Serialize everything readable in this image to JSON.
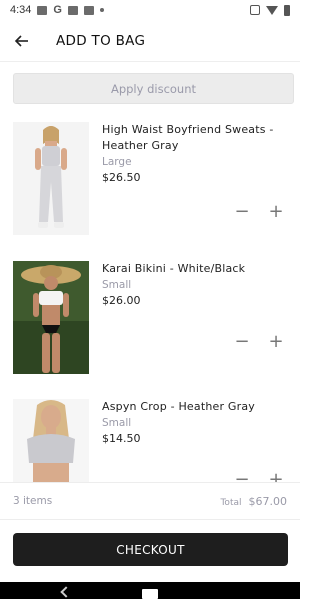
{
  "status_bar": {
    "time": "4:34",
    "icons": [
      "image-icon",
      "google-icon",
      "photo-icon",
      "square-icon",
      "dot-icon",
      "vibrate-icon",
      "wifi-icon",
      "battery-icon"
    ]
  },
  "header": {
    "title": "ADD TO BAG",
    "back_icon": "arrow-left-icon"
  },
  "discount": {
    "label": "Apply discount"
  },
  "items": [
    {
      "name": "High Waist Boyfriend Sweats - Heather Gray",
      "size": "Large",
      "price": "$26.50",
      "image": "model-gray-sweats"
    },
    {
      "name": "Karai Bikini - White/Black",
      "size": "Small",
      "price": "$26.00",
      "image": "model-bikini-hat"
    },
    {
      "name": "Aspyn Crop - Heather Gray",
      "size": "Small",
      "price": "$14.50",
      "image": "model-gray-crop"
    }
  ],
  "qty_controls": {
    "minus": "−",
    "plus": "+"
  },
  "summary": {
    "items_count": "3 items",
    "total_label": "Total",
    "total_value": "$67.00"
  },
  "checkout": {
    "label": "CHECKOUT"
  },
  "colors": {
    "checkout_bg": "#1e1e1e",
    "muted_text": "#9a9aa8",
    "discount_bg": "#ececec"
  }
}
